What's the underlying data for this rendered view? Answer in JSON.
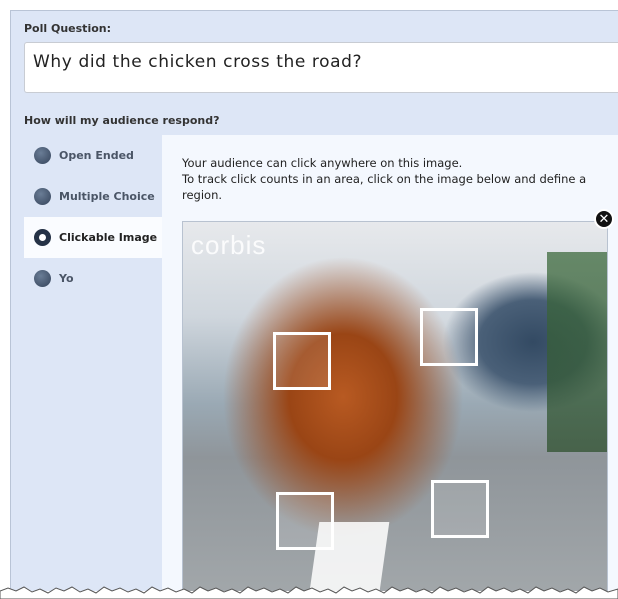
{
  "poll": {
    "question_label": "Poll Question:",
    "question_text": "Why did the chicken cross the road?"
  },
  "respond": {
    "label": "How will my audience respond?",
    "options": [
      {
        "label": "Open Ended",
        "selected": false
      },
      {
        "label": "Multiple Choice",
        "selected": false
      },
      {
        "label": "Clickable Image",
        "selected": true
      },
      {
        "label": "Yo",
        "selected": false
      }
    ]
  },
  "clickable_image": {
    "description_line1": "Your audience can click anywhere on this image.",
    "description_line2": "To track click counts in an area, click on the image below and define a region.",
    "watermark": "corbis",
    "regions_count": 4
  },
  "icons": {
    "close": "close-icon"
  },
  "colors": {
    "panel_bg": "#dde6f6",
    "content_bg": "#f4f8fe",
    "selected_option_bg": "#fafcff",
    "radio": "#34435a"
  }
}
